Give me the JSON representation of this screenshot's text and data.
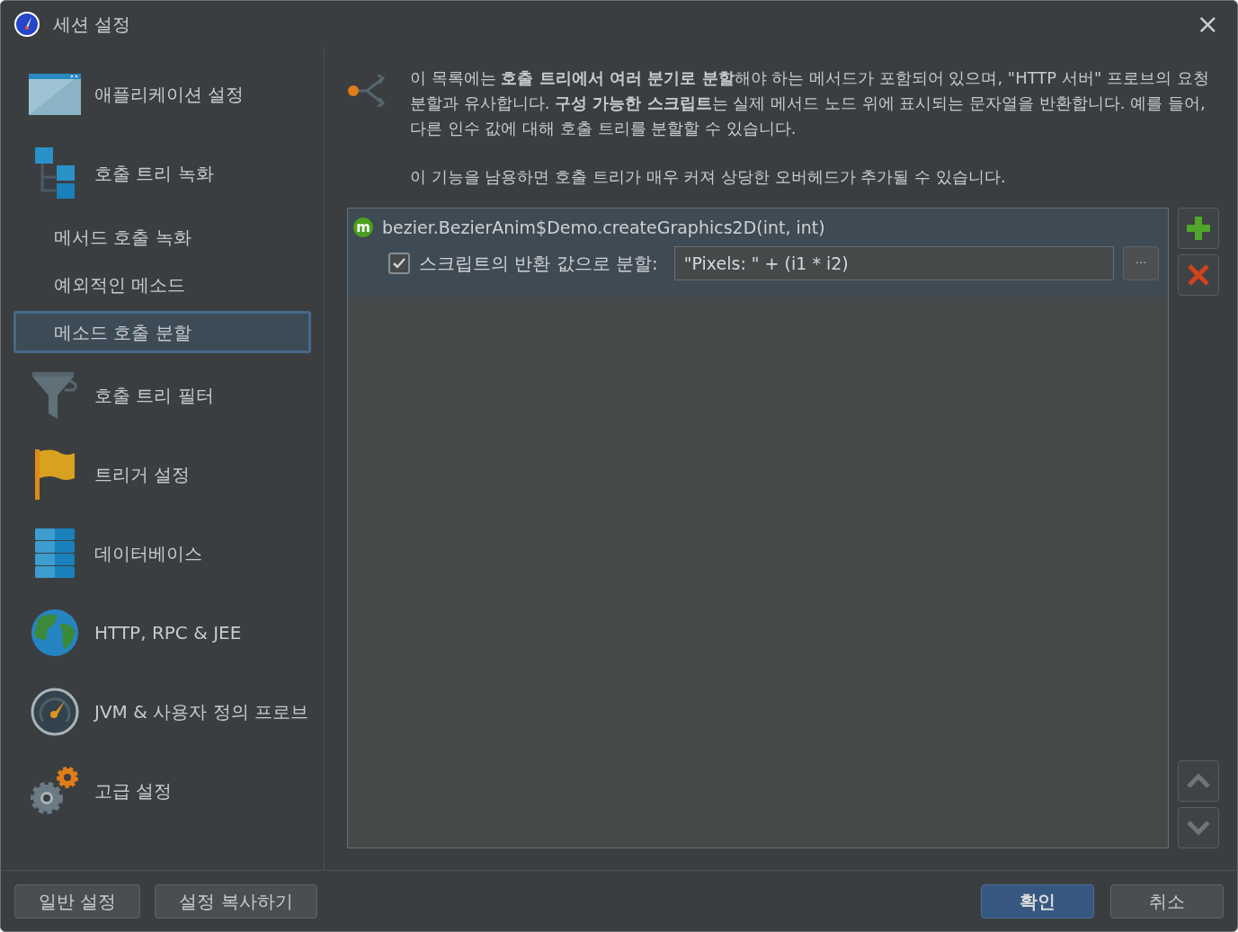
{
  "window": {
    "title": "세션 설정",
    "close": "×"
  },
  "sidebar": {
    "items": [
      {
        "kind": "major",
        "label": "애플리케이션 설정",
        "selected": false
      },
      {
        "kind": "major",
        "label": "호출 트리 녹화",
        "selected": false
      },
      {
        "kind": "sub",
        "label": "메서드 호출 녹화",
        "selected": false
      },
      {
        "kind": "sub",
        "label": "예외적인 메소드",
        "selected": false
      },
      {
        "kind": "sub",
        "label": "메소드 호출 분할",
        "selected": true
      },
      {
        "kind": "major",
        "label": "호출 트리 필터",
        "selected": false
      },
      {
        "kind": "major",
        "label": "트리거 설정",
        "selected": false
      },
      {
        "kind": "major",
        "label": "데이터베이스",
        "selected": false
      },
      {
        "kind": "major",
        "label": "HTTP, RPC & JEE",
        "selected": false
      },
      {
        "kind": "major",
        "label": "JVM & 사용자 정의 프로브",
        "selected": false
      },
      {
        "kind": "major",
        "label": "고급 설정",
        "selected": false
      }
    ]
  },
  "description": [
    "이 목록에는 **호출 트리에서 여러 분기로 분할**해야 하는 메서드가 포함되어 있으며, \"HTTP 서버\" 프로브의 요청 분할과 유사합니다. **구성 가능한 스크립트**는 실제 메서드 노드 위에 표시되는 문자열을 반환합니다. 예를 들어, 다른 인수 값에 대해 호출 트리를 분할할 수 있습니다.",
    "이 기능을 남용하면 호출 트리가 매우 커져 상당한 오버헤드가 추가될 수 있습니다."
  ],
  "methods": [
    {
      "badge": "m",
      "name": "bezier.BezierAnim$Demo.createGraphics2D(int, int)",
      "selected": true,
      "split": {
        "checked": true,
        "label": "스크립트의 반환 값으로 분할:",
        "value": "\"Pixels: \" + (i1 * i2)",
        "more": "···"
      }
    }
  ],
  "footer": {
    "left": [
      "일반 설정",
      "설정 복사하기"
    ],
    "ok": "확인",
    "cancel": "취소"
  }
}
